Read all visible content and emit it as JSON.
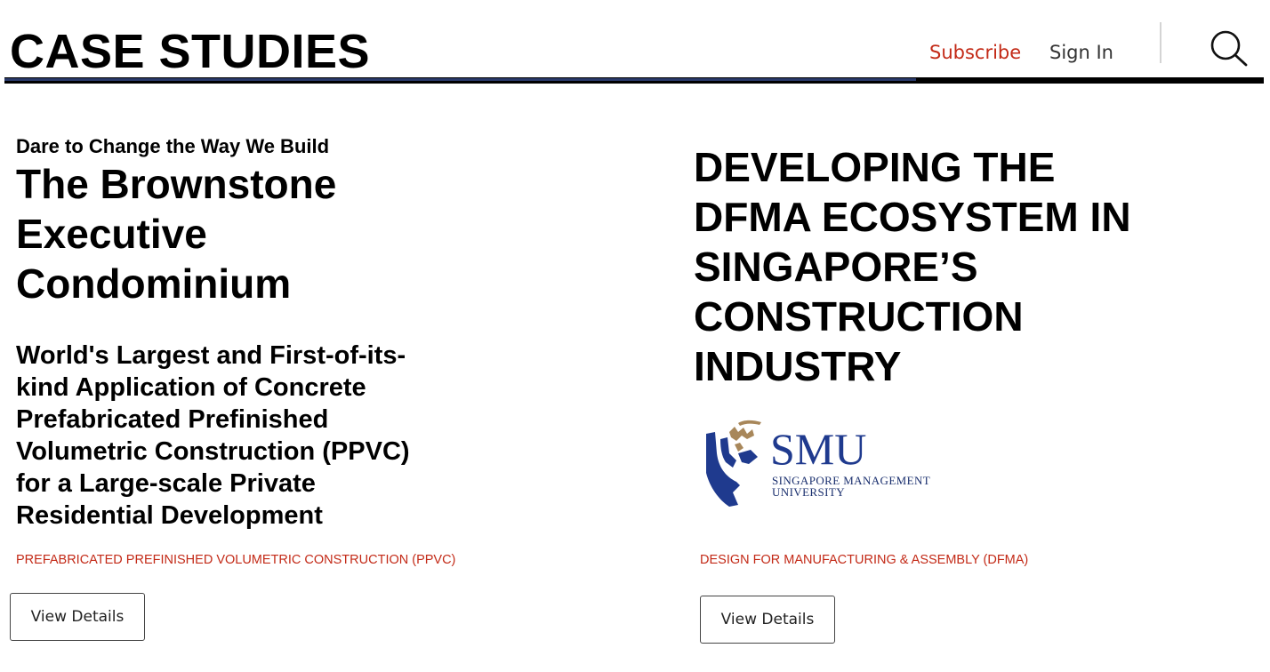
{
  "header": {
    "title": "CASE STUDIES",
    "subscribe_label": "Subscribe",
    "signin_label": "Sign In",
    "search_icon": "search-icon"
  },
  "cards": [
    {
      "kicker": "Dare to Change the Way We Build",
      "title": "The Brownstone Executive Condominium",
      "subtitle": "World's Largest and First-of-its-kind Application of Concrete Prefabricated Prefinished Volumetric Construction (PPVC) for a Large-scale Private Residential Development",
      "tag": "PREFABRICATED PREFINISHED VOLUMETRIC CONSTRUCTION (PPVC)",
      "button_label": "View Details"
    },
    {
      "title": "DEVELOPING THE DFMA ECOSYSTEM IN SINGAPORE’S CONSTRUCTION INDUSTRY",
      "logo": {
        "name": "SMU",
        "subtitle": "SINGAPORE MANAGEMENT\nUNIVERSITY",
        "icon": "smu-lion-logo-icon"
      },
      "tag": "DESIGN FOR MANUFACTURING & ASSEMBLY (DFMA)",
      "button_label": "View Details"
    }
  ],
  "colors": {
    "accent_red": "#c32a17",
    "rule_navy": "#2a3a6a",
    "smu_blue": "#1f3a8e",
    "smu_gold": "#a8875a"
  }
}
